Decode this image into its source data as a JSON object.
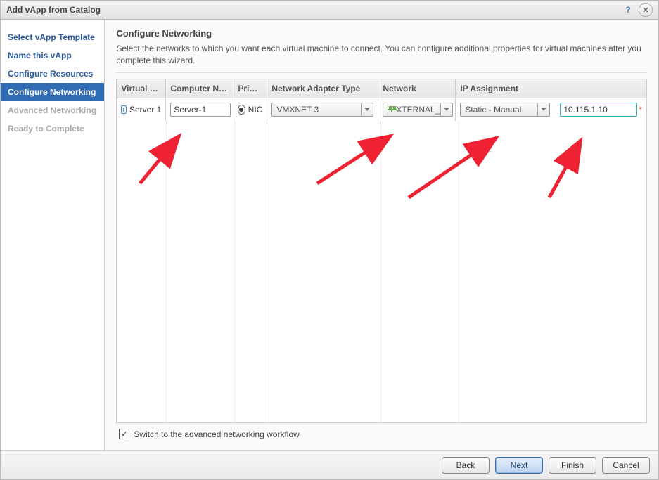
{
  "title": "Add vApp from Catalog",
  "icons": {
    "help": "?",
    "close": "✕"
  },
  "sidebar": {
    "items": [
      {
        "label": "Select vApp Template",
        "state": "link"
      },
      {
        "label": "Name this vApp",
        "state": "link"
      },
      {
        "label": "Configure Resources",
        "state": "link"
      },
      {
        "label": "Configure Networking",
        "state": "active"
      },
      {
        "label": "Advanced Networking",
        "state": "dim"
      },
      {
        "label": "Ready to Complete",
        "state": "dim"
      }
    ]
  },
  "page": {
    "heading": "Configure Networking",
    "description": "Select the networks to which you want each virtual machine to connect. You can configure additional properties for virtual machines after you complete this wizard."
  },
  "grid": {
    "columns": {
      "vm": "Virtual Machi",
      "computer": "Computer Nam",
      "primary": "Primar",
      "adapter": "Network Adapter Type",
      "network": "Network",
      "ipassign": "IP Assignment"
    },
    "row": {
      "vm": "Server 1",
      "computer": "Server-1",
      "primary": "NIC",
      "adapter": "VMXNET 3",
      "network": "EXTERNAL_DIRI",
      "ipmode": "Static - Manual",
      "ip": "10.115.1.10",
      "required": "*"
    }
  },
  "advanced": {
    "checked": true,
    "label": "Switch to the advanced networking workflow"
  },
  "footer": {
    "back": "Back",
    "next": "Next",
    "finish": "Finish",
    "cancel": "Cancel"
  }
}
